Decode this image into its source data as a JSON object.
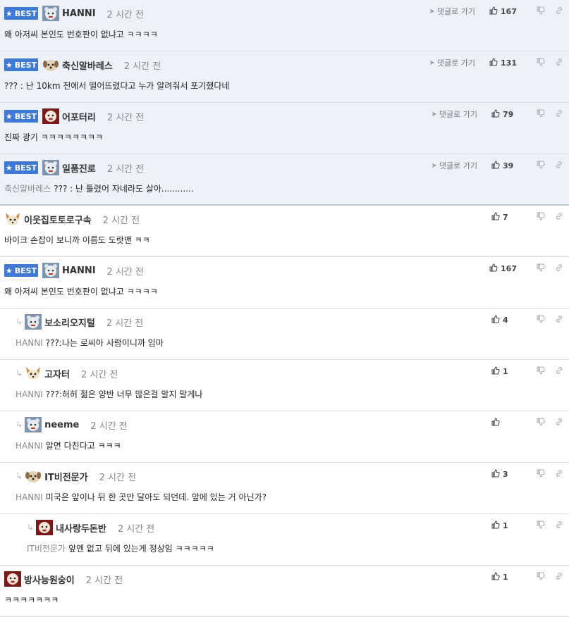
{
  "labels": {
    "best": "BEST",
    "goto": "댓글로 가기"
  },
  "colors": {
    "best_bg": "#edf2fa",
    "badge": "#3d7ad6"
  },
  "icons": {
    "thumb_up": "thumb-up-icon",
    "thumb_down": "thumb-down-icon",
    "link": "link-icon",
    "reply": "reply-arrow-icon",
    "star": "star-icon",
    "nav": "navigate-icon"
  },
  "comments": [
    {
      "best": true,
      "indent": 0,
      "avatar": "bear",
      "nick": "HANNI",
      "time": "2 시간 전",
      "likes": "167",
      "goto": true,
      "ref": "",
      "text": "왜 아저씨 본인도 번호판이 없냐고 ㅋㅋㅋㅋ"
    },
    {
      "best": true,
      "indent": 0,
      "avatar": "dog",
      "nick": "축신알바레스",
      "time": "2 시간 전",
      "likes": "131",
      "goto": true,
      "ref": "",
      "text": "??? : 난 10km 전에서 떨어뜨렸다고 누가 알려줘서 포기했다네"
    },
    {
      "best": true,
      "indent": 0,
      "avatar": "red",
      "nick": "어포터리",
      "time": "2 시간 전",
      "likes": "79",
      "goto": true,
      "ref": "",
      "text": "진짜 광기 ㅋㅋㅋㅋㅋㅋㅋㅋ"
    },
    {
      "best": true,
      "indent": 0,
      "avatar": "bear",
      "nick": "일품진로",
      "time": "2 시간 전",
      "likes": "39",
      "goto": true,
      "ref": "축신알바레스",
      "text": "??? : 난 틀렸어 자네라도 살아............"
    },
    {
      "best": false,
      "indent": 0,
      "avatar": "fox",
      "nick": "이웃집토토로구속",
      "time": "2 시간 전",
      "likes": "7",
      "goto": false,
      "ref": "",
      "text": "바이크 손잡이 보니까 이름도 도랏맨 ㅋㅋ"
    },
    {
      "best": true,
      "indent": 0,
      "avatar": "bear",
      "nick": "HANNI",
      "time": "2 시간 전",
      "likes": "167",
      "goto": false,
      "ref": "",
      "text": "왜 아저씨 본인도 번호판이 없냐고 ㅋㅋㅋㅋ"
    },
    {
      "best": false,
      "indent": 1,
      "avatar": "bear",
      "nick": "보소리오지털",
      "time": "2 시간 전",
      "likes": "4",
      "goto": false,
      "ref": "HANNI",
      "text": "???:나는 로씨아 사람이니까 임마"
    },
    {
      "best": false,
      "indent": 1,
      "avatar": "fox",
      "nick": "고자터",
      "time": "2 시간 전",
      "likes": "1",
      "goto": false,
      "ref": "HANNI",
      "text": "???:허허 젊은 양반 너무 많은걸 알지 말게나"
    },
    {
      "best": false,
      "indent": 1,
      "avatar": "bear",
      "nick": "neeme",
      "time": "2 시간 전",
      "likes": "",
      "goto": false,
      "ref": "HANNI",
      "text": "알면 다친다고 ㅋㅋㅋ"
    },
    {
      "best": false,
      "indent": 1,
      "avatar": "dog",
      "nick": "IT비전문가",
      "time": "2 시간 전",
      "likes": "3",
      "goto": false,
      "ref": "HANNI",
      "text": "미국은 앞이나 뒤 한 곳만 달아도 되던데. 앞에 있는 거 아닌가?"
    },
    {
      "best": false,
      "indent": 2,
      "avatar": "red",
      "nick": "내사랑두돈반",
      "time": "2 시간 전",
      "likes": "1",
      "goto": false,
      "ref": "IT비전문가",
      "text": "앞엔 없고 뒤에 있는게 정상임 ㅋㅋㅋㅋㅋ"
    },
    {
      "best": false,
      "indent": 0,
      "avatar": "red",
      "nick": "방사능원숭이",
      "time": "2 시간 전",
      "likes": "1",
      "goto": false,
      "ref": "",
      "text": "ㅋㅋㅋㅋㅋㅋㅋ"
    }
  ]
}
